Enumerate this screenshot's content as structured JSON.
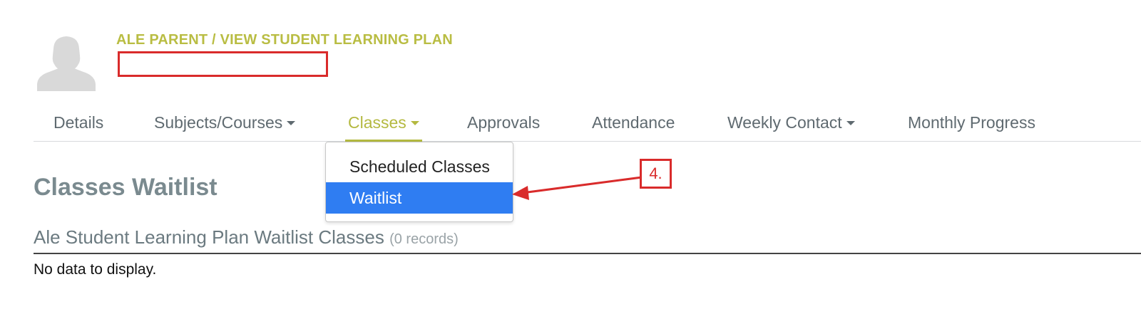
{
  "breadcrumb": "ALE PARENT / VIEW STUDENT LEARNING PLAN",
  "tabs": [
    {
      "label": "Details"
    },
    {
      "label": "Subjects/Courses"
    },
    {
      "label": "Classes"
    },
    {
      "label": "Approvals"
    },
    {
      "label": "Attendance"
    },
    {
      "label": "Weekly Contact"
    },
    {
      "label": "Monthly Progress"
    }
  ],
  "dropdown": {
    "items": [
      {
        "label": "Scheduled Classes"
      },
      {
        "label": "Waitlist"
      }
    ]
  },
  "page_title": "Classes Waitlist",
  "list": {
    "title": "Ale Student Learning Plan Waitlist Classes",
    "count": "(0 records)",
    "empty": "No data to display."
  },
  "annotation": {
    "step_label": "4."
  },
  "colors": {
    "accent": "#b4b940",
    "selected": "#2f7df2",
    "annotation_red": "#d92b2b"
  },
  "icons": [
    "user-avatar-icon",
    "caret-down-icon"
  ]
}
